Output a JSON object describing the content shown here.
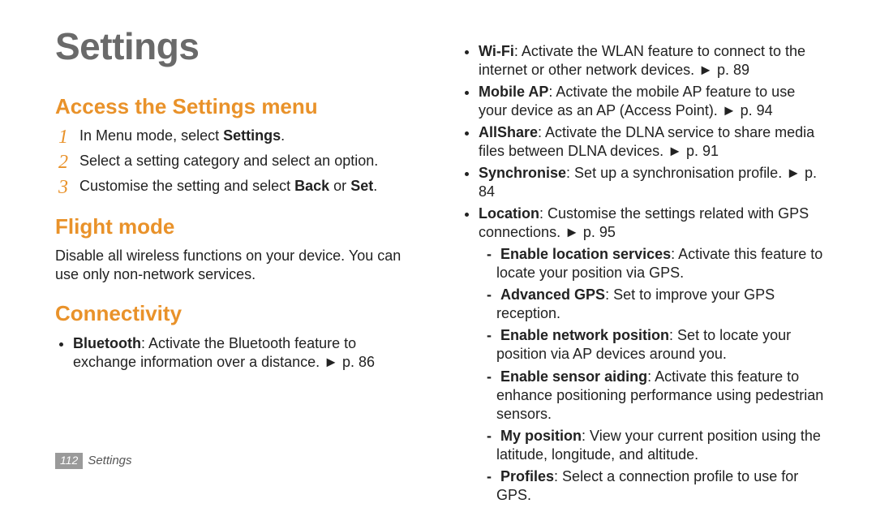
{
  "title": "Settings",
  "section_access": {
    "heading": "Access the Settings menu",
    "steps": [
      {
        "n": "1",
        "pre": "In Menu mode, select ",
        "bold": "Settings",
        "post": "."
      },
      {
        "n": "2",
        "text": "Select a setting category and select an option."
      },
      {
        "n": "3",
        "pre": "Customise the setting and select ",
        "bold1": "Back",
        "mid": " or ",
        "bold2": "Set",
        "post": "."
      }
    ]
  },
  "section_flight": {
    "heading": "Flight mode",
    "body": "Disable all wireless functions on your device. You can use only non-network services."
  },
  "section_conn": {
    "heading": "Connectivity",
    "items": {
      "bluetooth": {
        "label": "Bluetooth",
        "desc": ": Activate the Bluetooth feature to exchange information over a distance. ► p. 86"
      },
      "wifi": {
        "label": "Wi-Fi",
        "desc": ": Activate the WLAN feature to connect to the internet or other network devices. ► p. 89"
      },
      "mobileap": {
        "label": "Mobile AP",
        "desc": ": Activate the mobile AP feature to use your device as an AP (Access Point). ► p. 94"
      },
      "allshare": {
        "label": "AllShare",
        "desc": ": Activate the DLNA service to share media files between DLNA devices. ► p. 91"
      },
      "synchronise": {
        "label": "Synchronise",
        "desc": ": Set up a synchronisation profile. ► p. 84"
      },
      "location": {
        "label": "Location",
        "desc": ": Customise the settings related with GPS connections. ► p. 95"
      }
    },
    "location_sub": {
      "els": {
        "label": "Enable location services",
        "desc": ": Activate this feature to locate your position via GPS."
      },
      "agps": {
        "label": "Advanced GPS",
        "desc": ": Set to improve your GPS reception."
      },
      "enp": {
        "label": "Enable network position",
        "desc": ": Set to locate your position via AP devices around you."
      },
      "esa": {
        "label": "Enable sensor aiding",
        "desc": ": Activate this feature to enhance positioning performance using pedestrian sensors."
      },
      "mypos": {
        "label": "My position",
        "desc": ": View your current position using the latitude, longitude, and altitude."
      },
      "prof": {
        "label": "Profiles",
        "desc": ": Select a connection profile to use for GPS."
      }
    }
  },
  "footer": {
    "page": "112",
    "section": "Settings"
  }
}
